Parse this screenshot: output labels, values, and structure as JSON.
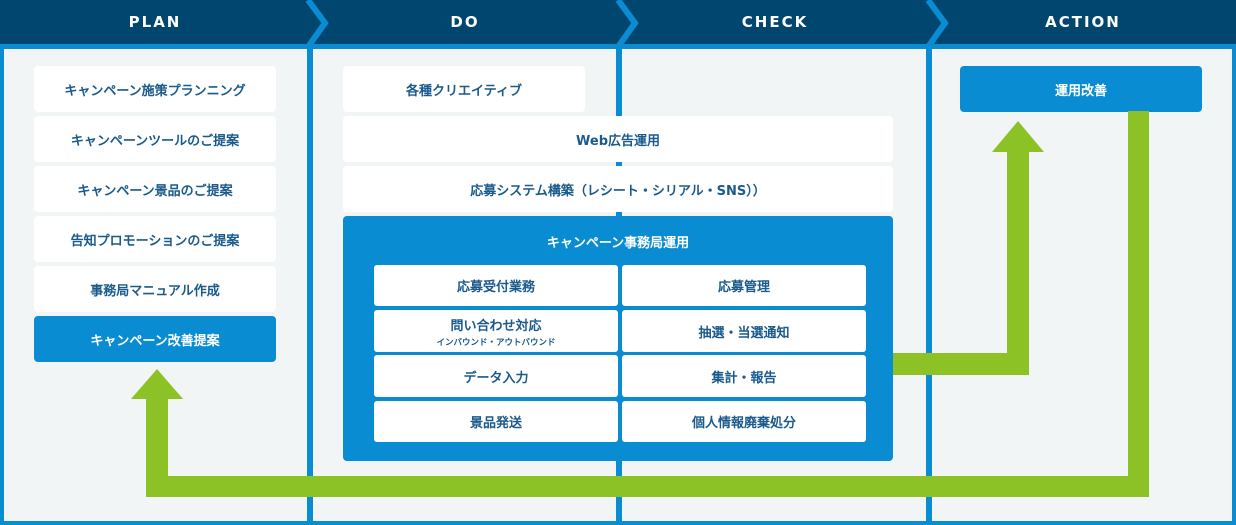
{
  "colors": {
    "header_bg": "#00466f",
    "accent_blue": "#0a8cd2",
    "panel_bg": "#f1f5f6",
    "box_text": "#1a5a8c",
    "arrow_green": "#8dc227"
  },
  "phases": [
    {
      "label": "PLAN"
    },
    {
      "label": "DO"
    },
    {
      "label": "CHECK"
    },
    {
      "label": "ACTION"
    }
  ],
  "plan": {
    "items": [
      "キャンペーン施策プランニング",
      "キャンペーンツールのご提案",
      "キャンペーン景品のご提案",
      "告知プロモーションのご提案",
      "事務局マニュアル作成"
    ],
    "highlight": "キャンペーン改善提案"
  },
  "do": {
    "creative": "各種クリエイティブ",
    "web_ads": "Web広告運用",
    "system": "応募システム構築（レシート・シリアル・SNS））",
    "office": {
      "title": "キャンペーン事務局運用",
      "cells": [
        {
          "label": "応募受付業務",
          "sub": ""
        },
        {
          "label": "応募管理",
          "sub": ""
        },
        {
          "label": "問い合わせ対応",
          "sub": "インバウンド・アウトバウンド"
        },
        {
          "label": "抽選・当選通知",
          "sub": ""
        },
        {
          "label": "データ入力",
          "sub": ""
        },
        {
          "label": "集計・報告",
          "sub": ""
        },
        {
          "label": "景品発送",
          "sub": ""
        },
        {
          "label": "個人情報廃棄処分",
          "sub": ""
        }
      ]
    }
  },
  "action": {
    "item": "運用改善"
  }
}
